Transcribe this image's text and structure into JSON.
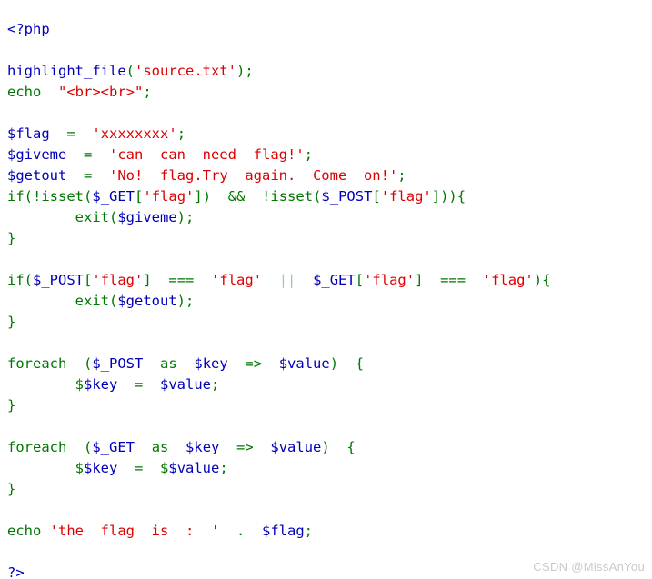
{
  "document": {
    "kind": "php-source-highlight",
    "background_color": "#FFFFFF",
    "palette": {
      "keyword": "#007700",
      "variable": "#0000BB",
      "string": "#DD0000",
      "default": "#0000BB",
      "pale_operator": "#9DCB9D",
      "plain": "#000000"
    },
    "code_lines": [
      {
        "index": 0,
        "text": "<?php",
        "tokens": [
          {
            "t": "<?php",
            "c": "tok-def"
          }
        ]
      },
      {
        "index": 1,
        "text": "",
        "tokens": []
      },
      {
        "index": 2,
        "text": "highlight_file('source.txt');",
        "tokens": [
          {
            "t": "highlight_file",
            "c": "tok-var"
          },
          {
            "t": "(",
            "c": "tok-kw"
          },
          {
            "t": "'source.txt'",
            "c": "tok-str"
          },
          {
            "t": ")",
            "c": "tok-kw"
          },
          {
            "t": ";",
            "c": "tok-kw"
          }
        ]
      },
      {
        "index": 3,
        "text": "echo  \"<br><br>\";",
        "tokens": [
          {
            "t": "echo",
            "c": "tok-kw"
          },
          {
            "t": "  ",
            "c": "tok-plain"
          },
          {
            "t": "\"<br><br>\"",
            "c": "tok-str"
          },
          {
            "t": ";",
            "c": "tok-kw"
          }
        ]
      },
      {
        "index": 4,
        "text": "",
        "tokens": []
      },
      {
        "index": 5,
        "text": "$flag  =  'xxxxxxxx';",
        "tokens": [
          {
            "t": "$flag",
            "c": "tok-var"
          },
          {
            "t": "  ",
            "c": "tok-plain"
          },
          {
            "t": "=",
            "c": "tok-kw"
          },
          {
            "t": "  ",
            "c": "tok-plain"
          },
          {
            "t": "'xxxxxxxx'",
            "c": "tok-str"
          },
          {
            "t": ";",
            "c": "tok-kw"
          }
        ]
      },
      {
        "index": 6,
        "text": "$giveme  =  'can  can  need  flag!';",
        "tokens": [
          {
            "t": "$giveme",
            "c": "tok-var"
          },
          {
            "t": "  ",
            "c": "tok-plain"
          },
          {
            "t": "=",
            "c": "tok-kw"
          },
          {
            "t": "  ",
            "c": "tok-plain"
          },
          {
            "t": "'can  can  need  flag!'",
            "c": "tok-str"
          },
          {
            "t": ";",
            "c": "tok-kw"
          }
        ]
      },
      {
        "index": 7,
        "text": "$getout  =  'No!  flag.Try  again.  Come  on!';",
        "tokens": [
          {
            "t": "$getout",
            "c": "tok-var"
          },
          {
            "t": "  ",
            "c": "tok-plain"
          },
          {
            "t": "=",
            "c": "tok-kw"
          },
          {
            "t": "  ",
            "c": "tok-plain"
          },
          {
            "t": "'No!  flag.Try  again.  Come  on!'",
            "c": "tok-str"
          },
          {
            "t": ";",
            "c": "tok-kw"
          }
        ]
      },
      {
        "index": 8,
        "text": "if(!isset($_GET['flag'])  &&  !isset($_POST['flag'])){",
        "tokens": [
          {
            "t": "if",
            "c": "tok-kw"
          },
          {
            "t": "(!",
            "c": "tok-kw"
          },
          {
            "t": "isset",
            "c": "tok-kw"
          },
          {
            "t": "(",
            "c": "tok-kw"
          },
          {
            "t": "$_GET",
            "c": "tok-var"
          },
          {
            "t": "[",
            "c": "tok-kw"
          },
          {
            "t": "'flag'",
            "c": "tok-str"
          },
          {
            "t": "])",
            "c": "tok-kw"
          },
          {
            "t": "  ",
            "c": "tok-plain"
          },
          {
            "t": "&&",
            "c": "tok-kw"
          },
          {
            "t": "  !",
            "c": "tok-kw"
          },
          {
            "t": "isset",
            "c": "tok-kw"
          },
          {
            "t": "(",
            "c": "tok-kw"
          },
          {
            "t": "$_POST",
            "c": "tok-var"
          },
          {
            "t": "[",
            "c": "tok-kw"
          },
          {
            "t": "'flag'",
            "c": "tok-str"
          },
          {
            "t": "])){",
            "c": "tok-kw"
          }
        ]
      },
      {
        "index": 9,
        "text": "        exit($giveme);",
        "tokens": [
          {
            "t": "        ",
            "c": "tok-plain"
          },
          {
            "t": "exit",
            "c": "tok-kw"
          },
          {
            "t": "(",
            "c": "tok-kw"
          },
          {
            "t": "$giveme",
            "c": "tok-var"
          },
          {
            "t": ");",
            "c": "tok-kw"
          }
        ]
      },
      {
        "index": 10,
        "text": "}",
        "tokens": [
          {
            "t": "}",
            "c": "tok-kw"
          }
        ]
      },
      {
        "index": 11,
        "text": "",
        "tokens": []
      },
      {
        "index": 12,
        "text": "if($_POST['flag']  ===  'flag'  ||  $_GET['flag']  ===  'flag'){",
        "tokens": [
          {
            "t": "if",
            "c": "tok-kw"
          },
          {
            "t": "(",
            "c": "tok-kw"
          },
          {
            "t": "$_POST",
            "c": "tok-var"
          },
          {
            "t": "[",
            "c": "tok-kw"
          },
          {
            "t": "'flag'",
            "c": "tok-str"
          },
          {
            "t": "]",
            "c": "tok-kw"
          },
          {
            "t": "  ",
            "c": "tok-plain"
          },
          {
            "t": "===",
            "c": "tok-kw"
          },
          {
            "t": "  ",
            "c": "tok-plain"
          },
          {
            "t": "'flag'",
            "c": "tok-str"
          },
          {
            "t": "  ",
            "c": "tok-plain"
          },
          {
            "t": "||",
            "c": "tok-pale"
          },
          {
            "t": "  ",
            "c": "tok-plain"
          },
          {
            "t": "$_GET",
            "c": "tok-var"
          },
          {
            "t": "[",
            "c": "tok-kw"
          },
          {
            "t": "'flag'",
            "c": "tok-str"
          },
          {
            "t": "]",
            "c": "tok-kw"
          },
          {
            "t": "  ",
            "c": "tok-plain"
          },
          {
            "t": "===",
            "c": "tok-kw"
          },
          {
            "t": "  ",
            "c": "tok-plain"
          },
          {
            "t": "'flag'",
            "c": "tok-str"
          },
          {
            "t": "){",
            "c": "tok-kw"
          }
        ]
      },
      {
        "index": 13,
        "text": "        exit($getout);",
        "tokens": [
          {
            "t": "        ",
            "c": "tok-plain"
          },
          {
            "t": "exit",
            "c": "tok-kw"
          },
          {
            "t": "(",
            "c": "tok-kw"
          },
          {
            "t": "$getout",
            "c": "tok-var"
          },
          {
            "t": ");",
            "c": "tok-kw"
          }
        ]
      },
      {
        "index": 14,
        "text": "}",
        "tokens": [
          {
            "t": "}",
            "c": "tok-kw"
          }
        ]
      },
      {
        "index": 15,
        "text": "",
        "tokens": []
      },
      {
        "index": 16,
        "text": "foreach  ($_POST  as  $key  =>  $value)  {",
        "tokens": [
          {
            "t": "foreach",
            "c": "tok-kw"
          },
          {
            "t": "  ",
            "c": "tok-plain"
          },
          {
            "t": "(",
            "c": "tok-kw"
          },
          {
            "t": "$_POST",
            "c": "tok-var"
          },
          {
            "t": "  ",
            "c": "tok-plain"
          },
          {
            "t": "as",
            "c": "tok-kw"
          },
          {
            "t": "  ",
            "c": "tok-plain"
          },
          {
            "t": "$key",
            "c": "tok-var"
          },
          {
            "t": "  ",
            "c": "tok-plain"
          },
          {
            "t": "=>",
            "c": "tok-kw"
          },
          {
            "t": "  ",
            "c": "tok-plain"
          },
          {
            "t": "$value",
            "c": "tok-var"
          },
          {
            "t": ")",
            "c": "tok-kw"
          },
          {
            "t": "  ",
            "c": "tok-plain"
          },
          {
            "t": "{",
            "c": "tok-kw"
          }
        ]
      },
      {
        "index": 17,
        "text": "        $$key  =  $value;",
        "tokens": [
          {
            "t": "        ",
            "c": "tok-plain"
          },
          {
            "t": "$",
            "c": "tok-kw"
          },
          {
            "t": "$key",
            "c": "tok-var"
          },
          {
            "t": "  ",
            "c": "tok-plain"
          },
          {
            "t": "=",
            "c": "tok-kw"
          },
          {
            "t": "  ",
            "c": "tok-plain"
          },
          {
            "t": "$value",
            "c": "tok-var"
          },
          {
            "t": ";",
            "c": "tok-kw"
          }
        ]
      },
      {
        "index": 18,
        "text": "}",
        "tokens": [
          {
            "t": "}",
            "c": "tok-kw"
          }
        ]
      },
      {
        "index": 19,
        "text": "",
        "tokens": []
      },
      {
        "index": 20,
        "text": "foreach  ($_GET  as  $key  =>  $value)  {",
        "tokens": [
          {
            "t": "foreach",
            "c": "tok-kw"
          },
          {
            "t": "  ",
            "c": "tok-plain"
          },
          {
            "t": "(",
            "c": "tok-kw"
          },
          {
            "t": "$_GET",
            "c": "tok-var"
          },
          {
            "t": "  ",
            "c": "tok-plain"
          },
          {
            "t": "as",
            "c": "tok-kw"
          },
          {
            "t": "  ",
            "c": "tok-plain"
          },
          {
            "t": "$key",
            "c": "tok-var"
          },
          {
            "t": "  ",
            "c": "tok-plain"
          },
          {
            "t": "=>",
            "c": "tok-kw"
          },
          {
            "t": "  ",
            "c": "tok-plain"
          },
          {
            "t": "$value",
            "c": "tok-var"
          },
          {
            "t": ")",
            "c": "tok-kw"
          },
          {
            "t": "  ",
            "c": "tok-plain"
          },
          {
            "t": "{",
            "c": "tok-kw"
          }
        ]
      },
      {
        "index": 21,
        "text": "        $$key  =  $$value;",
        "tokens": [
          {
            "t": "        ",
            "c": "tok-plain"
          },
          {
            "t": "$",
            "c": "tok-kw"
          },
          {
            "t": "$key",
            "c": "tok-var"
          },
          {
            "t": "  ",
            "c": "tok-plain"
          },
          {
            "t": "=",
            "c": "tok-kw"
          },
          {
            "t": "  ",
            "c": "tok-plain"
          },
          {
            "t": "$",
            "c": "tok-kw"
          },
          {
            "t": "$value",
            "c": "tok-var"
          },
          {
            "t": ";",
            "c": "tok-kw"
          }
        ]
      },
      {
        "index": 22,
        "text": "}",
        "tokens": [
          {
            "t": "}",
            "c": "tok-kw"
          }
        ]
      },
      {
        "index": 23,
        "text": "",
        "tokens": []
      },
      {
        "index": 24,
        "text": "echo 'the  flag  is  :  '  .  $flag;",
        "tokens": [
          {
            "t": "echo",
            "c": "tok-kw"
          },
          {
            "t": " ",
            "c": "tok-plain"
          },
          {
            "t": "'the  flag  is  :  '",
            "c": "tok-str"
          },
          {
            "t": "  ",
            "c": "tok-plain"
          },
          {
            "t": ".",
            "c": "tok-kw"
          },
          {
            "t": "  ",
            "c": "tok-plain"
          },
          {
            "t": "$flag",
            "c": "tok-var"
          },
          {
            "t": ";",
            "c": "tok-kw"
          }
        ]
      },
      {
        "index": 25,
        "text": "",
        "tokens": []
      },
      {
        "index": 26,
        "text": "?>",
        "tokens": [
          {
            "t": "?>",
            "c": "tok-def"
          }
        ]
      }
    ]
  },
  "watermark": {
    "text": "CSDN @MissAnYou",
    "color": "#C9C9C9"
  }
}
